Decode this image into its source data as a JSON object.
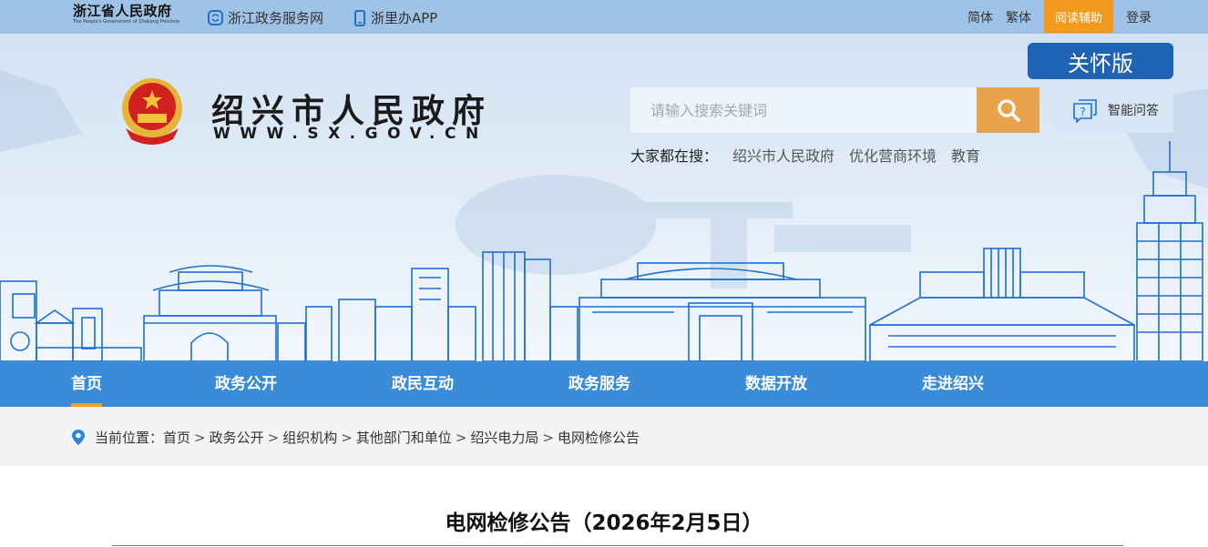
{
  "topbar": {
    "logo_cn": "浙江省人民政府",
    "logo_en": "The People's Government of Zhejiang Province",
    "link_service": "浙江政务服务网",
    "link_app": "浙里办APP",
    "simplified": "简体",
    "traditional": "繁体",
    "reading_aid": "阅读辅助",
    "login": "登录"
  },
  "banner": {
    "care_version": "关怀版",
    "site_title": "绍兴市人民政府",
    "site_url": "WWW.SX.GOV.CN",
    "search_placeholder": "请输入搜索关键词",
    "qa_label": "智能问答",
    "hot_label": "大家都在搜：",
    "hot_items": [
      "绍兴市人民政府",
      "优化营商环境",
      "教育"
    ]
  },
  "nav": {
    "items": [
      "首页",
      "政务公开",
      "政民互动",
      "政务服务",
      "数据开放",
      "走进绍兴"
    ],
    "active": "首页"
  },
  "breadcrumb": {
    "label": "当前位置：",
    "items": [
      "首页",
      "政务公开",
      "组织机构",
      "其他部门和单位",
      "绍兴电力局",
      "电网检修公告"
    ],
    "separator": ">"
  },
  "article": {
    "title": "电网检修公告（2026年2月5日）"
  },
  "colors": {
    "topbar_bg": "#9fc3e6",
    "nav_bg": "#3a8bd8",
    "accent_orange": "#f29a1f",
    "care_btn": "#1f63b4",
    "search_btn": "#e8a44c",
    "skyline_stroke": "#1f6fd0"
  },
  "icons": {
    "service": "service-network-icon",
    "app": "phone-app-icon",
    "search": "search-icon",
    "qa": "chat-question-icon",
    "location": "location-pin-icon",
    "emblem": "national-emblem-icon"
  }
}
